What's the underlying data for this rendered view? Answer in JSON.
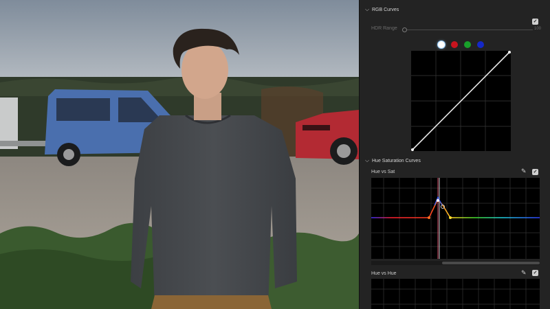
{
  "rgb_curves": {
    "title": "RGB Curves",
    "enabled": true,
    "hdr_range": {
      "label": "HDR Range",
      "value": "100"
    },
    "channels": [
      {
        "name": "white-channel",
        "color": "#ffffff",
        "selected": true
      },
      {
        "name": "red-channel",
        "color": "#c8141e",
        "selected": false
      },
      {
        "name": "green-channel",
        "color": "#18a02a",
        "selected": false
      },
      {
        "name": "blue-channel",
        "color": "#1428c8",
        "selected": false
      }
    ]
  },
  "hue_saturation": {
    "title": "Hue Saturation Curves",
    "hue_vs_sat": {
      "label": "Hue vs Sat",
      "enabled": true
    },
    "hue_vs_hue": {
      "label": "Hue vs Hue",
      "enabled": true
    }
  },
  "icons": {
    "collapse": "chevron-down-icon",
    "eyedropper": "eyedropper-icon",
    "checkbox": "checkbox-checked-icon"
  }
}
